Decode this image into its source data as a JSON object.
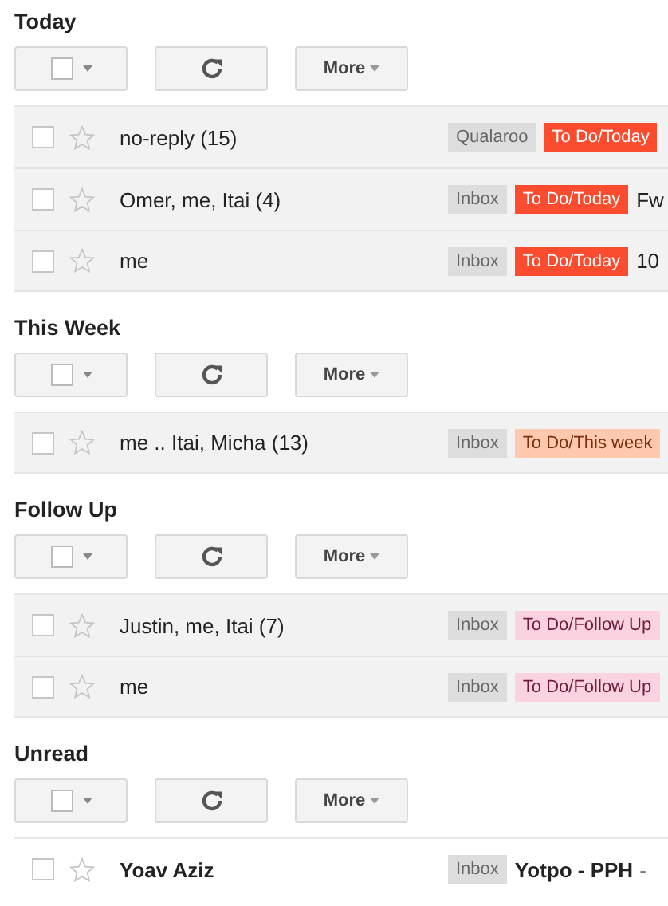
{
  "sections": [
    {
      "title": "Today",
      "toolbar": {
        "more": "More"
      },
      "rows": [
        {
          "sender": "no-reply (15)",
          "unread": false,
          "checked": false,
          "starred": false,
          "labels": [
            {
              "text": "Qualaroo",
              "color": "#dddddd"
            },
            {
              "text": "To Do/Today",
              "color": "#fb4c2f"
            }
          ]
        },
        {
          "sender": "Omer, me, Itai (4)",
          "unread": false,
          "checked": false,
          "starred": false,
          "labels": [
            {
              "text": "Inbox",
              "color": "#dddddd"
            },
            {
              "text": "To Do/Today",
              "color": "#fb4c2f"
            }
          ],
          "subject": "Fw"
        },
        {
          "sender": "me",
          "unread": false,
          "checked": false,
          "starred": false,
          "labels": [
            {
              "text": "Inbox",
              "color": "#dddddd"
            },
            {
              "text": "To Do/Today",
              "color": "#fb4c2f"
            }
          ],
          "subject": "10"
        }
      ]
    },
    {
      "title": "This Week",
      "toolbar": {
        "more": "More"
      },
      "rows": [
        {
          "sender": "me .. Itai, Micha (13)",
          "unread": false,
          "checked": false,
          "starred": false,
          "labels": [
            {
              "text": "Inbox",
              "color": "#dddddd"
            },
            {
              "text": "To Do/This week",
              "color": "#ffc8af"
            }
          ]
        }
      ]
    },
    {
      "title": "Follow Up",
      "toolbar": {
        "more": "More"
      },
      "rows": [
        {
          "sender": "Justin, me, Itai (7)",
          "unread": false,
          "checked": false,
          "starred": false,
          "labels": [
            {
              "text": "Inbox",
              "color": "#dddddd"
            },
            {
              "text": "To Do/Follow Up",
              "color": "#fbd3e0"
            }
          ]
        },
        {
          "sender": "me",
          "unread": false,
          "checked": false,
          "starred": false,
          "labels": [
            {
              "text": "Inbox",
              "color": "#dddddd"
            },
            {
              "text": "To Do/Follow Up",
              "color": "#fbd3e0"
            }
          ]
        }
      ]
    },
    {
      "title": "Unread",
      "toolbar": {
        "more": "More"
      },
      "rows": [
        {
          "sender": "Yoav Aziz",
          "unread": true,
          "checked": false,
          "starred": false,
          "labels": [
            {
              "text": "Inbox",
              "color": "#dddddd"
            }
          ],
          "subject": "Yotpo - PPH",
          "snippet": "-"
        }
      ]
    }
  ]
}
